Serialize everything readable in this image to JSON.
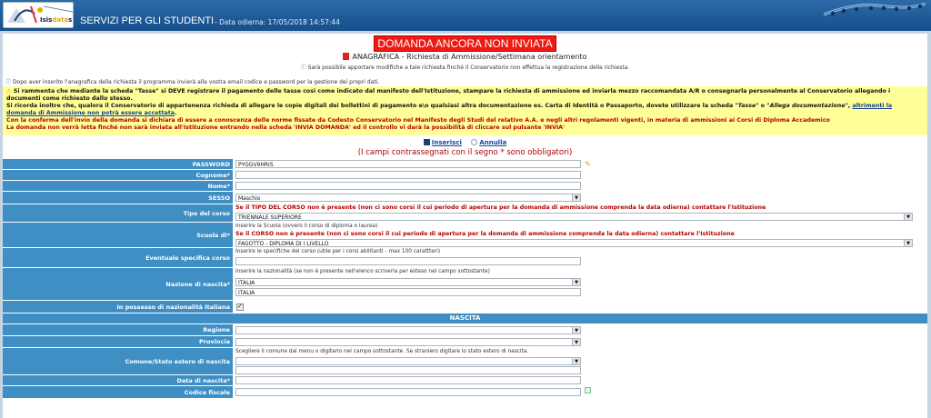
{
  "header": {
    "title": "SERVIZI PER GLI STUDENTI",
    "date_label": "- Data odierna: 17/05/2018 14:57:44",
    "logo_text_a": "Isis",
    "logo_text_b": "data",
    "logo_text_c": "srl"
  },
  "status_banner": "DOMANDA ANCORA NON INVIATA",
  "page_title": "ANAGRAFICA - Richiesta di Ammissione/Settimana orientamento",
  "page_subnote": "Sarà possibile apportare modifiche a tale richiesta finché il Conservatorio non effettua la registrazione della richiesta.",
  "after_note": "Dopo aver inserito l'anagrafica della richiesta il programma invierà alla vostra email codice e password per la gestione dei propri dati.",
  "notice": {
    "line1": "Si rammenta che mediante la scheda \"Tasse\" si DEVE registrare il pagamento delle tasse così come indicato dal manifesto dell'Istituzione, stampare la richiesta di ammissione ed inviarla mezzo raccomandata A/R o consegnarla personalmente al Conservatorio allegando i documenti come richiesto dallo stesso.",
    "line2_a": "Si ricorda inoltre che, qualora il Conservatorio di appartenenza richieda di allegare le copie digitali dei bollettini di pagamento e\\o qualsiasi altra documentazione es. Carta di Identità o Passaporto, dovete utilizzare la scheda ",
    "line2_tab1": "\"Tasse\"",
    "line2_o": " o ",
    "line2_tab2": "\"Allega documentazione\"",
    "line2_b": ", ",
    "line2_link": "altrimenti la domanda di Ammissione non potrà essere accettata",
    "line2_end": ".",
    "line3": "Con la conferma dell'invio della domanda si dichiara di essere a conoscenza delle norme fissate da Codesto Conservatorio nel Manifesto degli Studi del relativo A.A. e negli altri regolamenti vigenti, in materia di ammissioni ai Corsi di Diploma Accademico",
    "line4": "La domanda non verrà letta finché non sarà inviata all'Istituzione entrando nella scheda 'INVIA DOMANDA' ed il controllo vi darà la possibilità di cliccare sul pulsante 'INVIA'"
  },
  "actions": {
    "save": "Inserisci",
    "cancel": "Annulla"
  },
  "required_note": "(I campi contrassegnati con il segno * sono obbligatori)",
  "form": {
    "password": {
      "label": "PASSWORD",
      "value": "PYGGV9HRIS"
    },
    "cognome": {
      "label": "Cognome*",
      "value": ""
    },
    "nome": {
      "label": "Nome*",
      "value": ""
    },
    "sesso": {
      "label": "SESSO",
      "value": "Maschio"
    },
    "tipo_corso": {
      "label": "Tipo del corso",
      "hint": "Se il TIPO DEL CORSO non è presente (non ci sono corsi il cui periodo di apertura per la domanda di ammissione comprenda la data odierna) contattare l'Istituzione",
      "value": "TRIENNALE SUPERIORE"
    },
    "scuola": {
      "label": "Scuola di*",
      "hint1": "Inserire la Scuola (ovvero il corso di diploma o laurea)",
      "hint2": "Se il CORSO non è presente (non ci sono corsi il cui periodo di apertura per la domanda di ammissione comprenda la data odierna) contattare l'Istituzione",
      "value": "FAGOTTO - DIPLOMA DI I LIVELLO"
    },
    "specifica": {
      "label": "Eventuale specifica corso",
      "hint": "Inserire le specifiche del corso (utile per i corsi abilitanti - max 100 carattteri)",
      "value": ""
    },
    "nazione": {
      "label": "Nazione di nascita*",
      "hint": "Inserire la nazionalità (se non è presente nell'elenco scriverla per esteso nel campo sottostante)",
      "value": "ITALIA",
      "value2": "ITALIA"
    },
    "nazionalita": {
      "label": "In possesso di nazionalità Italiana"
    },
    "nascita_section": "NASCITA",
    "regione": {
      "label": "Regione",
      "value": ""
    },
    "provincia": {
      "label": "Provincia",
      "value": ""
    },
    "comune": {
      "label": "Comune/Stato estero di nascita",
      "hint": "Scegliere il comune dal menu o digitarlo nel campo sottostante. Se straniero digitare lo stato estero di nascita.",
      "value": ""
    },
    "data_nascita": {
      "label": "Data di nascita*",
      "value": ""
    },
    "codice_fiscale": {
      "label": "Codice fiscale",
      "value": ""
    }
  },
  "colors": {
    "header": "#1f5c9a",
    "label_bg": "#3f8ec4",
    "banner": "#ef1a14",
    "notice_bg": "#ffff99",
    "required": "#b10000"
  },
  "icons": [
    "pdf-icon",
    "info-icon",
    "warning-icon",
    "save-icon",
    "undo-icon",
    "key-icon",
    "edit-icon",
    "dropdown-arrow-icon"
  ]
}
